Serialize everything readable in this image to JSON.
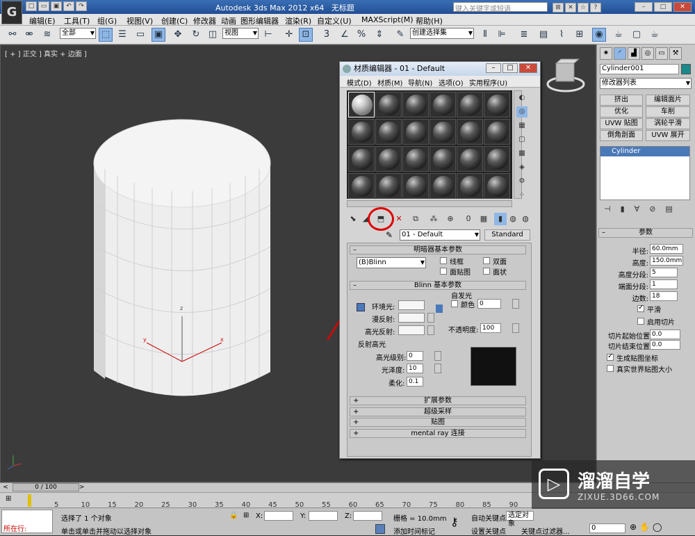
{
  "app": {
    "title": "Autodesk 3ds Max  2012 x64",
    "doc": "无标题",
    "search_placeholder": "键入关键字或短语"
  },
  "menu": [
    "编辑(E)",
    "工具(T)",
    "组(G)",
    "视图(V)",
    "创建(C)",
    "修改器",
    "动画",
    "图形编辑器",
    "渲染(R)",
    "自定义(U)",
    "MAXScript(M)",
    "帮助(H)"
  ],
  "toolbar": {
    "filter": "全部",
    "view": "视图",
    "selset": "创建选择集"
  },
  "viewport": {
    "label": "[ + ] 正交 ] 真实 + 边面 ]",
    "axes": {
      "z": "z",
      "x": "x",
      "y": "y"
    }
  },
  "material_editor": {
    "title": "材质编辑器 - 01 - Default",
    "menus": [
      "模式(D)",
      "材质(M)",
      "导航(N)",
      "选项(O)",
      "实用程序(U)"
    ],
    "material_name": "01 - Default",
    "type_button": "Standard",
    "shader_section": "明暗器基本参数",
    "shader": "(B)Blinn",
    "wire": "线框",
    "two_sided": "双面",
    "face_map": "面贴图",
    "faceted": "面状",
    "blinn_section": "Blinn 基本参数",
    "self_illum": "自发光",
    "color": "颜色",
    "self_illum_val": "0",
    "ambient": "环境光:",
    "diffuse": "漫反射:",
    "specular": "高光反射:",
    "opacity": "不透明度:",
    "opacity_val": "100",
    "spec_section": "反射高光",
    "spec_level": "高光级别:",
    "spec_level_val": "0",
    "gloss": "光泽度:",
    "gloss_val": "10",
    "soften": "柔化:",
    "soften_val": "0.1",
    "rollouts": [
      "扩展参数",
      "超级采样",
      "贴图",
      "mental ray 连接"
    ]
  },
  "command_panel": {
    "object": "Cylinder001",
    "modlist": "修改器列表",
    "buttons": [
      "挤出",
      "编辑面片",
      "优化",
      "车削",
      "UVW 贴图",
      "涡轮平滑",
      "倒角剖面",
      "UVW 展开"
    ],
    "stack_item": "Cylinder",
    "params_title": "参数",
    "params": [
      {
        "label": "半径:",
        "value": "60.0mm"
      },
      {
        "label": "高度:",
        "value": "150.0mm"
      },
      {
        "label": "高度分段:",
        "value": "5"
      },
      {
        "label": "端面分段:",
        "value": "1"
      },
      {
        "label": "边数:",
        "value": "18"
      }
    ],
    "smooth": "平滑",
    "slice_on": "启用切片",
    "slice_from": "切片起始位置:",
    "slice_to": "切片结束位置:",
    "slice_from_val": "0.0",
    "slice_to_val": "0.0",
    "gen_map": "生成贴图坐标",
    "real_world": "真实世界贴图大小"
  },
  "timeline": {
    "frame": "0 / 100",
    "ticks": [
      "5",
      "10",
      "15",
      "20",
      "25",
      "30",
      "35",
      "40",
      "45",
      "50",
      "55",
      "60",
      "65",
      "70",
      "75",
      "80",
      "85",
      "90"
    ]
  },
  "status": {
    "sel": "选择了 1 个对象",
    "hint": "单击或单击并拖动以选择对象",
    "running": "所在行:",
    "grid": "栅格 = 10.0mm",
    "auto_key": "自动关键点",
    "set_key": "设置关键点",
    "selected": "选定对象",
    "add_tag": "添加时间标记",
    "key_filter": "关键点过滤器...",
    "x": "X:",
    "y": "Y:",
    "z": "Z:",
    "frame_val": "0"
  },
  "watermark": {
    "brand": "溜溜自学",
    "url": "ZIXUE.3D66.COM"
  },
  "colors": {
    "highlight_circle": "#e00000",
    "arrow": "#e00000"
  }
}
